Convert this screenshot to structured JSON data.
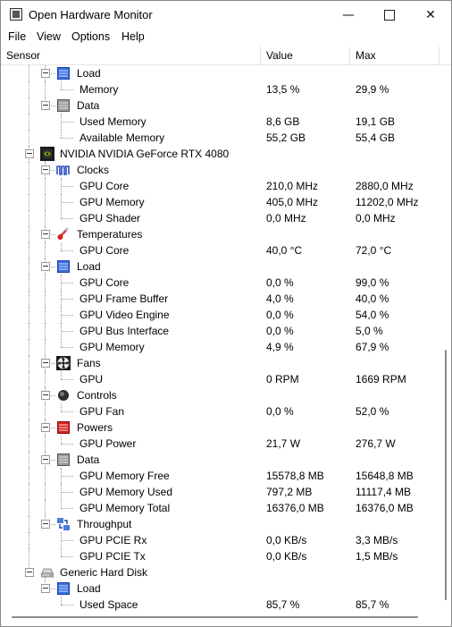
{
  "window": {
    "title": "Open Hardware Monitor"
  },
  "menu": [
    "File",
    "View",
    "Options",
    "Help"
  ],
  "columns": {
    "sensor": "Sensor",
    "value": "Value",
    "max": "Max"
  },
  "rows": [
    {
      "level": 2,
      "kind": "group",
      "icon": "load-icon",
      "name": "Load",
      "value": "",
      "max": ""
    },
    {
      "level": 3,
      "kind": "sensor",
      "name": "Memory",
      "value": "13,5 %",
      "max": "29,9 %"
    },
    {
      "level": 2,
      "kind": "group",
      "icon": "data-icon",
      "name": "Data",
      "value": "",
      "max": ""
    },
    {
      "level": 3,
      "kind": "sensor",
      "name": "Used Memory",
      "value": "8,6 GB",
      "max": "19,1 GB"
    },
    {
      "level": 3,
      "kind": "sensor",
      "name": "Available Memory",
      "value": "55,2 GB",
      "max": "55,4 GB"
    },
    {
      "level": 1,
      "kind": "hardware",
      "icon": "nvidia-gpu-icon",
      "name": "NVIDIA NVIDIA GeForce RTX 4080",
      "value": "",
      "max": ""
    },
    {
      "level": 2,
      "kind": "group",
      "icon": "clock-icon",
      "name": "Clocks",
      "value": "",
      "max": ""
    },
    {
      "level": 3,
      "kind": "sensor",
      "name": "GPU Core",
      "value": "210,0 MHz",
      "max": "2880,0 MHz"
    },
    {
      "level": 3,
      "kind": "sensor",
      "name": "GPU Memory",
      "value": "405,0 MHz",
      "max": "11202,0 MHz"
    },
    {
      "level": 3,
      "kind": "sensor",
      "name": "GPU Shader",
      "value": "0,0 MHz",
      "max": "0,0 MHz"
    },
    {
      "level": 2,
      "kind": "group",
      "icon": "thermometer-icon",
      "name": "Temperatures",
      "value": "",
      "max": ""
    },
    {
      "level": 3,
      "kind": "sensor",
      "name": "GPU Core",
      "value": "40,0 °C",
      "max": "72,0 °C"
    },
    {
      "level": 2,
      "kind": "group",
      "icon": "load-icon",
      "name": "Load",
      "value": "",
      "max": ""
    },
    {
      "level": 3,
      "kind": "sensor",
      "name": "GPU Core",
      "value": "0,0 %",
      "max": "99,0 %"
    },
    {
      "level": 3,
      "kind": "sensor",
      "name": "GPU Frame Buffer",
      "value": "4,0 %",
      "max": "40,0 %"
    },
    {
      "level": 3,
      "kind": "sensor",
      "name": "GPU Video Engine",
      "value": "0,0 %",
      "max": "54,0 %"
    },
    {
      "level": 3,
      "kind": "sensor",
      "name": "GPU Bus Interface",
      "value": "0,0 %",
      "max": "5,0 %"
    },
    {
      "level": 3,
      "kind": "sensor",
      "name": "GPU Memory",
      "value": "4,9 %",
      "max": "67,9 %"
    },
    {
      "level": 2,
      "kind": "group",
      "icon": "fan-icon",
      "name": "Fans",
      "value": "",
      "max": ""
    },
    {
      "level": 3,
      "kind": "sensor",
      "name": "GPU",
      "value": "0 RPM",
      "max": "1669 RPM"
    },
    {
      "level": 2,
      "kind": "group",
      "icon": "control-icon",
      "name": "Controls",
      "value": "",
      "max": ""
    },
    {
      "level": 3,
      "kind": "sensor",
      "name": "GPU Fan",
      "value": "0,0 %",
      "max": "52,0 %"
    },
    {
      "level": 2,
      "kind": "group",
      "icon": "power-icon",
      "name": "Powers",
      "value": "",
      "max": ""
    },
    {
      "level": 3,
      "kind": "sensor",
      "name": "GPU Power",
      "value": "21,7 W",
      "max": "276,7 W"
    },
    {
      "level": 2,
      "kind": "group",
      "icon": "data-icon",
      "name": "Data",
      "value": "",
      "max": ""
    },
    {
      "level": 3,
      "kind": "sensor",
      "name": "GPU Memory Free",
      "value": "15578,8 MB",
      "max": "15648,8 MB"
    },
    {
      "level": 3,
      "kind": "sensor",
      "name": "GPU Memory Used",
      "value": "797,2 MB",
      "max": "11117,4 MB"
    },
    {
      "level": 3,
      "kind": "sensor",
      "name": "GPU Memory Total",
      "value": "16376,0 MB",
      "max": "16376,0 MB"
    },
    {
      "level": 2,
      "kind": "group",
      "icon": "throughput-icon",
      "name": "Throughput",
      "value": "",
      "max": ""
    },
    {
      "level": 3,
      "kind": "sensor",
      "name": "GPU PCIE Rx",
      "value": "0,0 KB/s",
      "max": "3,3 MB/s"
    },
    {
      "level": 3,
      "kind": "sensor",
      "name": "GPU PCIE Tx",
      "value": "0,0 KB/s",
      "max": "1,5 MB/s"
    },
    {
      "level": 1,
      "kind": "hardware",
      "icon": "hard-disk-icon",
      "name": "Generic Hard Disk",
      "value": "",
      "max": ""
    },
    {
      "level": 2,
      "kind": "group",
      "icon": "load-icon",
      "name": "Load",
      "value": "",
      "max": ""
    },
    {
      "level": 3,
      "kind": "sensor",
      "name": "Used Space",
      "value": "85,7 %",
      "max": "85,7 %"
    }
  ]
}
